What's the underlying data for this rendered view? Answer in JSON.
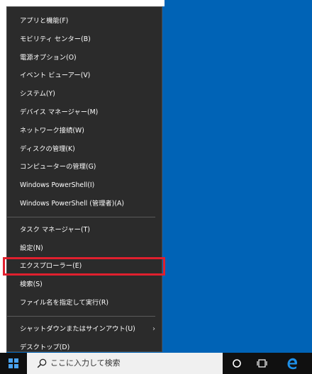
{
  "menu": {
    "items_group1": [
      {
        "label": "アプリと機能(F)"
      },
      {
        "label": "モビリティ センター(B)"
      },
      {
        "label": "電源オプション(O)"
      },
      {
        "label": "イベント ビューアー(V)"
      },
      {
        "label": "システム(Y)"
      },
      {
        "label": "デバイス マネージャー(M)"
      },
      {
        "label": "ネットワーク接続(W)"
      },
      {
        "label": "ディスクの管理(K)"
      },
      {
        "label": "コンピューターの管理(G)"
      },
      {
        "label": "Windows PowerShell(I)"
      },
      {
        "label": "Windows PowerShell (管理者)(A)"
      }
    ],
    "items_group2": [
      {
        "label": "タスク マネージャー(T)"
      },
      {
        "label": "設定(N)"
      },
      {
        "label": "エクスプローラー(E)",
        "highlighted": true
      },
      {
        "label": "検索(S)"
      },
      {
        "label": "ファイル名を指定して実行(R)"
      }
    ],
    "items_group3": [
      {
        "label": "シャットダウンまたはサインアウト(U)",
        "has_submenu": true
      },
      {
        "label": "デスクトップ(D)"
      }
    ],
    "submenu_glyph": "›"
  },
  "taskbar": {
    "search_placeholder": "ここに入力して検索",
    "icons": [
      "windows-start-icon",
      "search-icon",
      "cortana-icon",
      "task-view-icon",
      "edge-icon"
    ]
  },
  "colors": {
    "desktop": "#0063b6",
    "menu_bg": "#2b2b2b",
    "highlight_border": "#e0202e",
    "taskbar": "#101010"
  }
}
